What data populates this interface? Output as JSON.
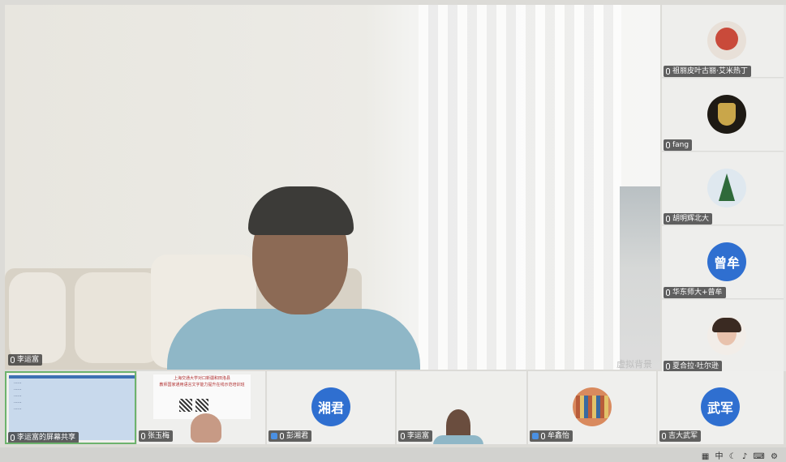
{
  "main_speaker": {
    "name": "李运富",
    "watermark": "虚拟背景"
  },
  "sidebar_participants": [
    {
      "name": "祖丽皮叶古丽·艾米热丁",
      "avatar_type": "photo",
      "avatar_color": "#c94a3a"
    },
    {
      "name": "fang",
      "avatar_type": "photo",
      "avatar_color": "#2b2418"
    },
    {
      "name": "胡明辉北大",
      "avatar_type": "photo",
      "avatar_color": "#2f6a3a"
    },
    {
      "name": "华东师大+曾牟",
      "avatar_type": "initials",
      "initials": "曾牟",
      "avatar_color": "#2f6fd0"
    },
    {
      "name": "夏合拉·吐尔逊",
      "avatar_type": "photo",
      "avatar_color": "#6b4a3a"
    }
  ],
  "bottom_tiles": [
    {
      "name": "李运富的屏幕共享",
      "type": "screenshare"
    },
    {
      "name": "张玉梅",
      "type": "flyer",
      "flyer_line1": "上海交通大学对口新疆和田洛县",
      "flyer_line2": "教师国家通用语言文字能力提升在线示范培训班"
    },
    {
      "name": "彭湘君",
      "type": "initials",
      "initials": "湘君",
      "avatar_color": "#2f6fd0"
    },
    {
      "name": "李运富",
      "type": "video"
    },
    {
      "name": "牟鑫怡",
      "type": "photo",
      "avatar_color": "#b85c3a"
    },
    {
      "name": "吉大武军",
      "type": "initials",
      "initials": "武军",
      "avatar_color": "#2f6fd0"
    }
  ],
  "status_icons": [
    "grid-icon",
    "cn-input-icon",
    "moon-icon",
    "mic-icon",
    "keyboard-icon",
    "gear-icon"
  ],
  "status_text": "中"
}
